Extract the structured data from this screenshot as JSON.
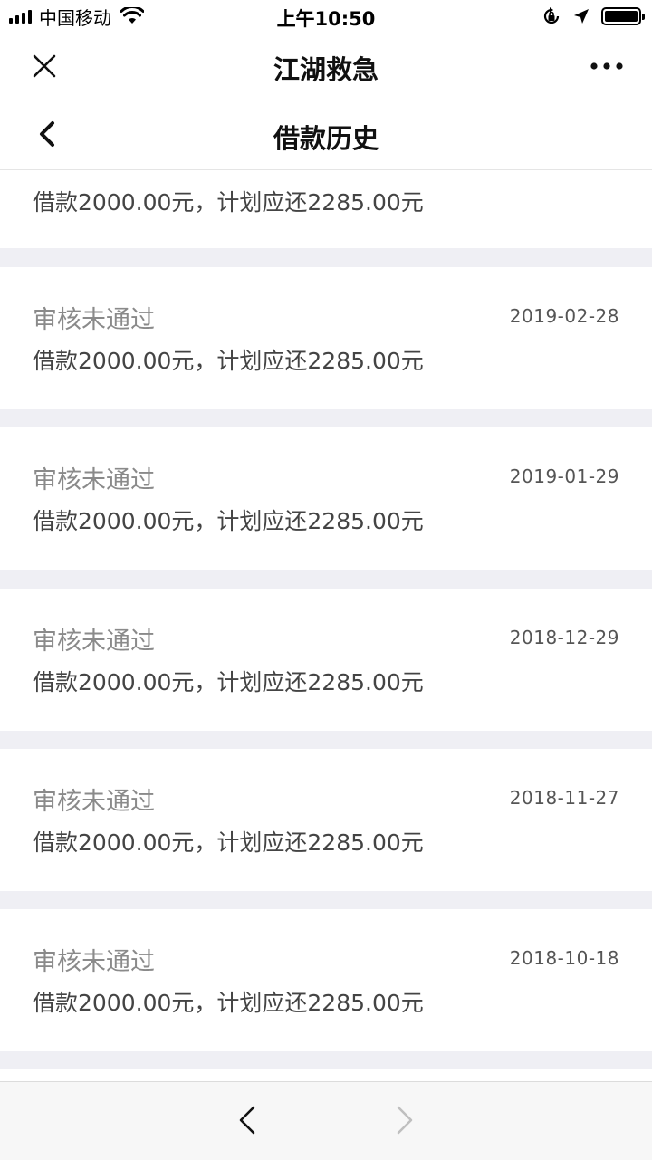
{
  "status_bar": {
    "carrier": "中国移动",
    "time": "上午10:50"
  },
  "app_bar": {
    "title": "江湖救急",
    "close_icon": "close-icon",
    "more_icon": "more-dots-icon"
  },
  "page": {
    "title": "借款历史",
    "back_icon": "chevron-left-icon"
  },
  "partial_item": {
    "desc": "借款2000.00元，计划应还2285.00元"
  },
  "items": [
    {
      "status": "审核未通过",
      "date": "2019-02-28",
      "desc": "借款2000.00元，计划应还2285.00元"
    },
    {
      "status": "审核未通过",
      "date": "2019-01-29",
      "desc": "借款2000.00元，计划应还2285.00元"
    },
    {
      "status": "审核未通过",
      "date": "2018-12-29",
      "desc": "借款2000.00元，计划应还2285.00元"
    },
    {
      "status": "审核未通过",
      "date": "2018-11-27",
      "desc": "借款2000.00元，计划应还2285.00元"
    },
    {
      "status": "审核未通过",
      "date": "2018-10-18",
      "desc": "借款2000.00元，计划应还2285.00元"
    }
  ],
  "bottom_bar": {
    "prev_icon": "arrow-left-icon",
    "next_icon": "arrow-right-icon",
    "colors": {
      "enabled": "#111111",
      "disabled": "#bfbfbf"
    }
  },
  "colors": {
    "background": "#efeff4",
    "card": "#ffffff",
    "status_text": "#8a8a8a"
  }
}
